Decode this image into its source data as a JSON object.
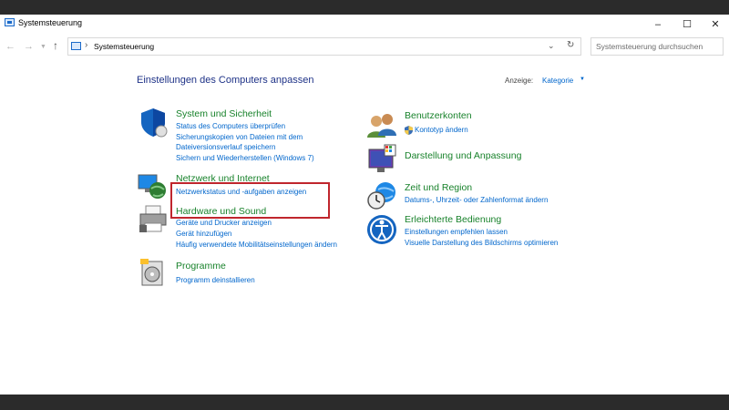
{
  "window": {
    "title": "Systemsteuerung"
  },
  "address": {
    "path": "Systemsteuerung",
    "search_placeholder": "Systemsteuerung durchsuchen"
  },
  "header": {
    "heading": "Einstellungen des Computers anpassen",
    "view_label": "Anzeige:",
    "view_value": "Kategorie"
  },
  "left_categories": [
    {
      "title": "System und Sicherheit",
      "icon": "shield-icon",
      "links": [
        "Status des Computers überprüfen",
        "Sicherungskopien von Dateien mit dem",
        "Dateiversionsverlauf speichern",
        "Sichern und Wiederherstellen (Windows 7)"
      ]
    },
    {
      "title": "Netzwerk und Internet",
      "icon": "network-globe-icon",
      "links": [
        "Netzwerkstatus und -aufgaben anzeigen"
      ]
    },
    {
      "title": "Hardware und Sound",
      "icon": "printer-icon",
      "links": [
        "Geräte und Drucker anzeigen",
        "Gerät hinzufügen",
        "Häufig verwendete Mobilitätseinstellungen ändern"
      ]
    },
    {
      "title": "Programme",
      "icon": "programs-disc-icon",
      "links": [
        "Programm deinstallieren"
      ]
    }
  ],
  "right_categories": [
    {
      "title": "Benutzerkonten",
      "icon": "users-icon",
      "links": [
        "Kontotyp ändern"
      ]
    },
    {
      "title": "Darstellung und Anpassung",
      "icon": "monitor-palette-icon",
      "links": []
    },
    {
      "title": "Zeit und Region",
      "icon": "clock-globe-icon",
      "links": [
        "Datums-, Uhrzeit- oder Zahlenformat ändern"
      ]
    },
    {
      "title": "Erleichterte Bedienung",
      "icon": "accessibility-icon",
      "links": [
        "Einstellungen empfehlen lassen",
        "Visuelle Darstellung des Bildschirms optimieren"
      ]
    }
  ]
}
